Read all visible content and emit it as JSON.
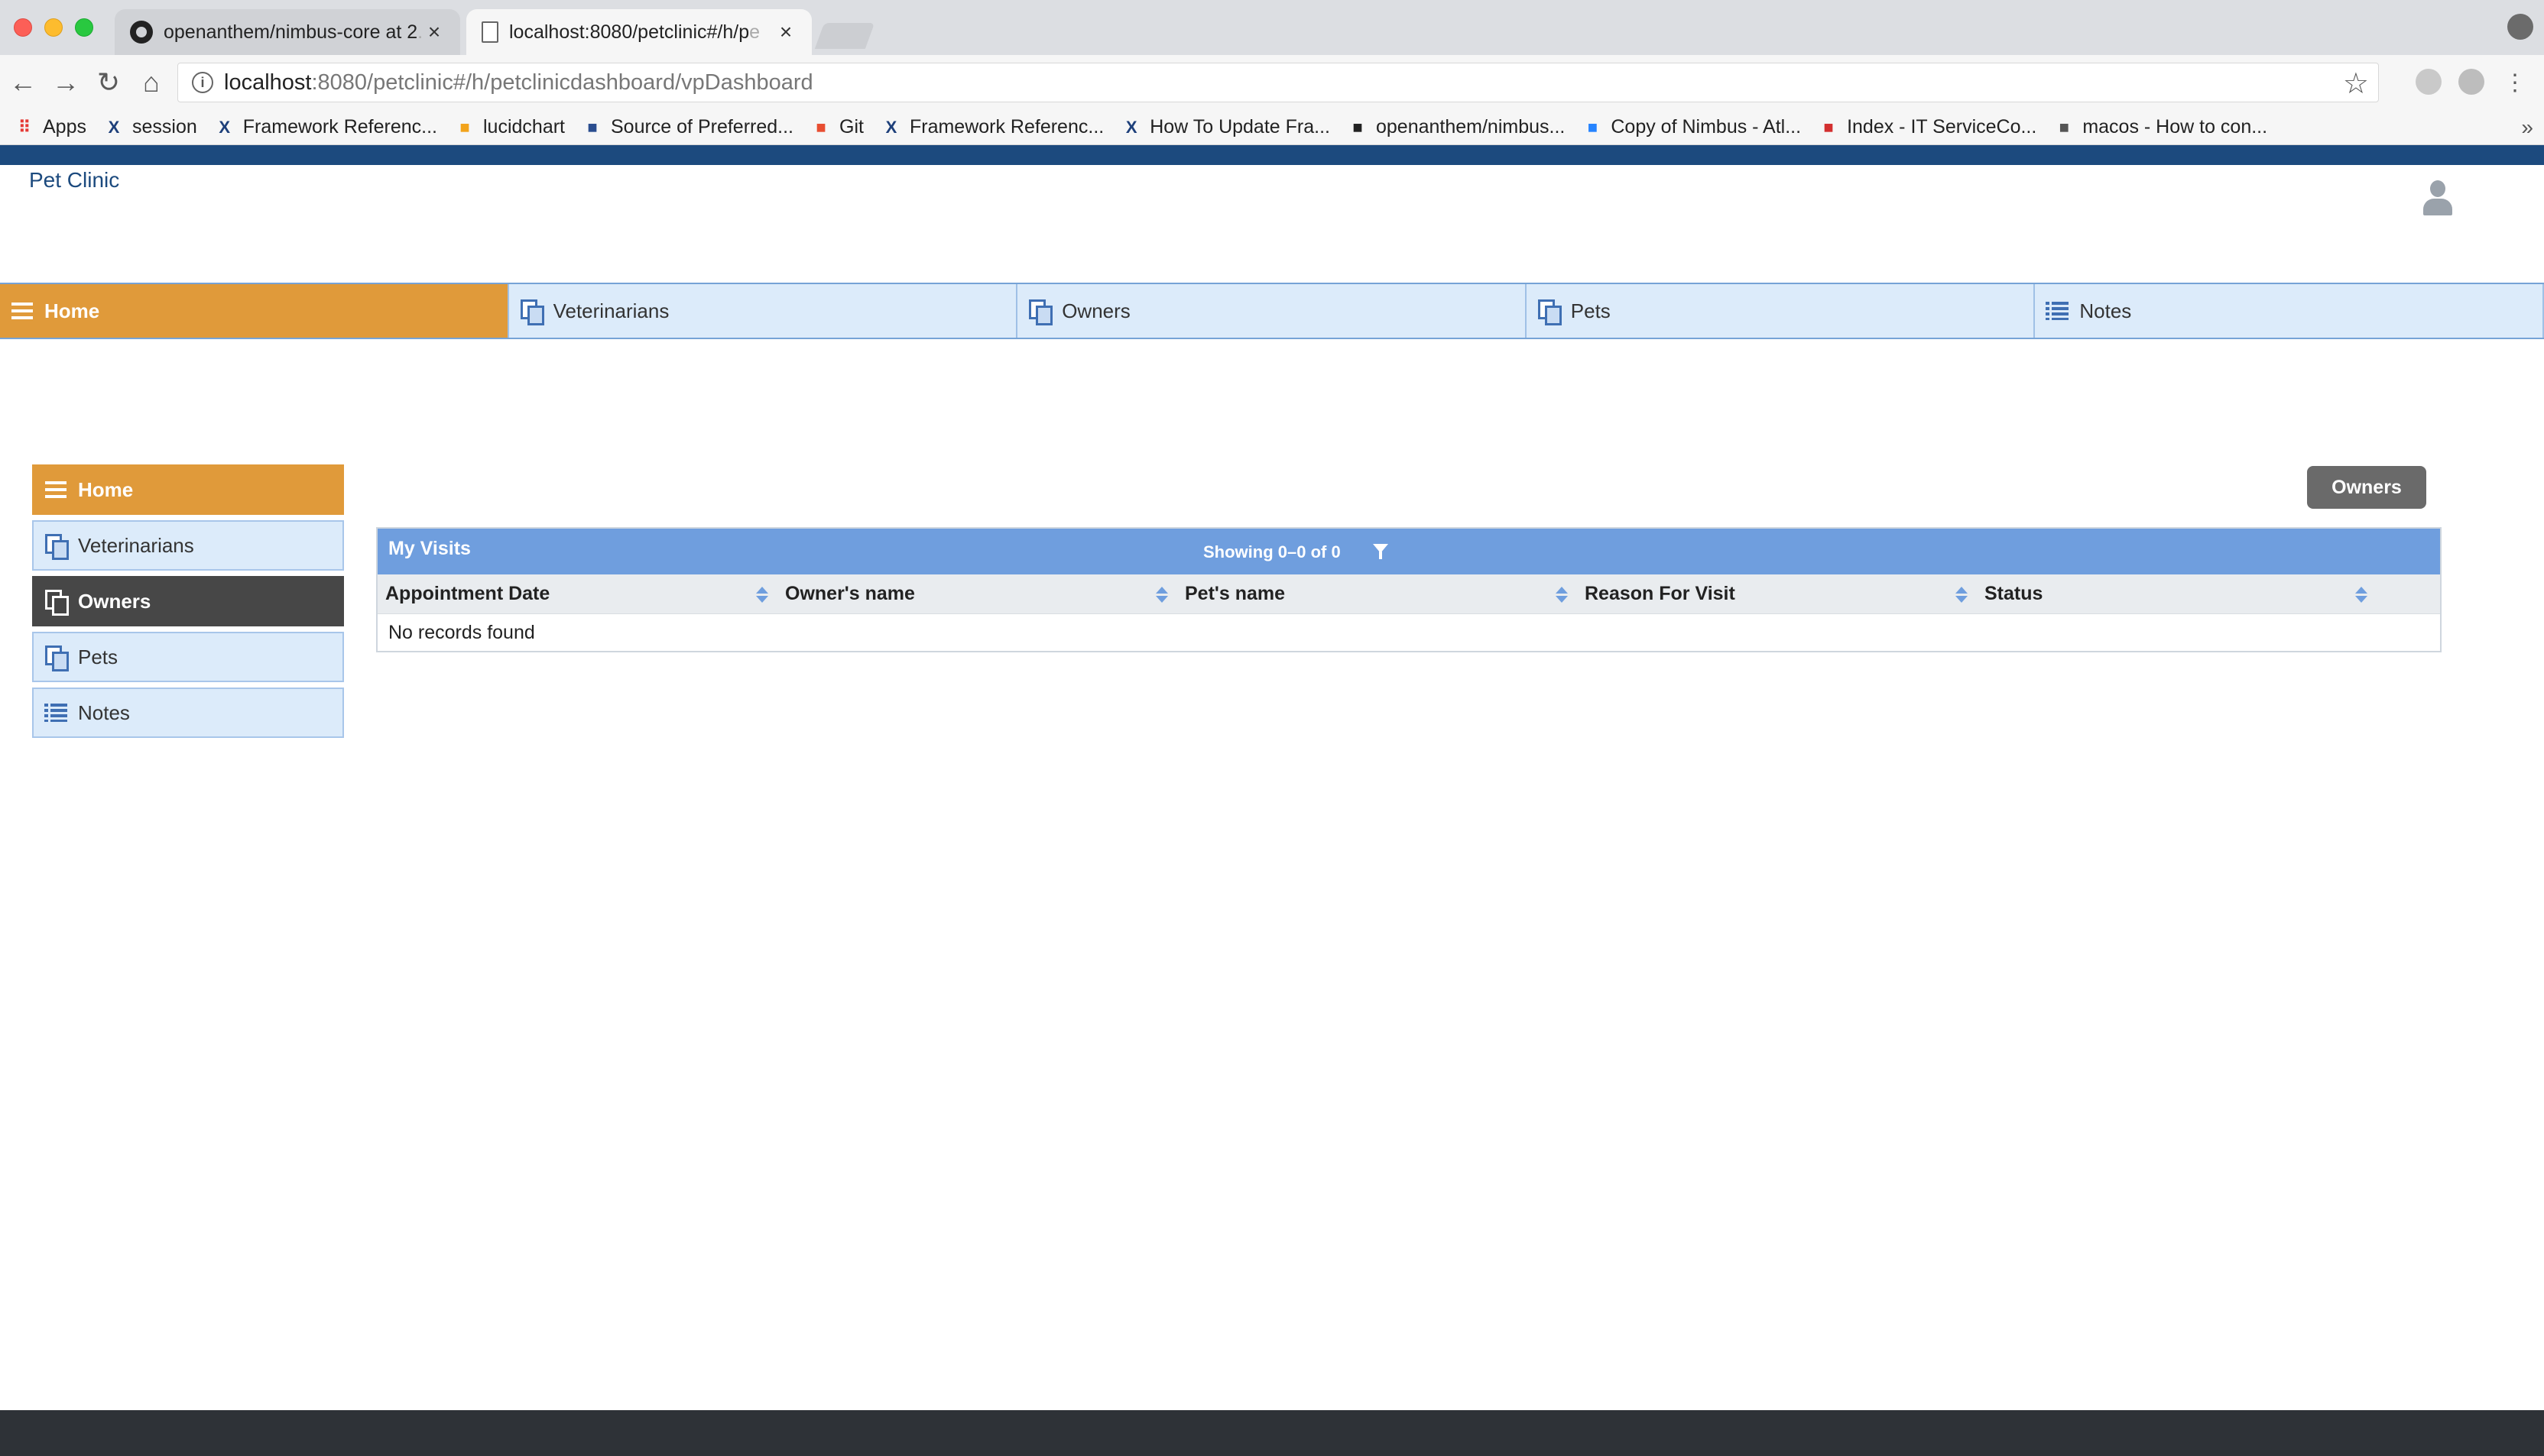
{
  "browser": {
    "tabs": [
      {
        "title": "openanthem/nimbus-core at 2",
        "title_faded": ".",
        "icon": "github-icon"
      },
      {
        "title": "localhost:8080/petclinic#/h/p",
        "title_faded": "e",
        "icon": "document-icon"
      }
    ],
    "url": {
      "host": "localhost",
      "rest": ":8080/petclinic#/h/petclinicdashboard/vpDashboard"
    },
    "bookmarks": [
      {
        "label": "Apps",
        "icon": "apps-grid-icon",
        "color": "#e53935"
      },
      {
        "label": "session",
        "icon": "x-icon",
        "color": "#1d3f7a"
      },
      {
        "label": "Framework Referenc...",
        "icon": "x-icon",
        "color": "#1d3f7a"
      },
      {
        "label": "lucidchart",
        "icon": "lucidchart-icon",
        "color": "#f2a31b"
      },
      {
        "label": "Source of Preferred...",
        "icon": "shield-icon",
        "color": "#2a4d8f"
      },
      {
        "label": "Git",
        "icon": "git-icon",
        "color": "#e84e31"
      },
      {
        "label": "Framework Referenc...",
        "icon": "x-icon",
        "color": "#1d3f7a"
      },
      {
        "label": "How To Update Fra...",
        "icon": "x-icon",
        "color": "#1d3f7a"
      },
      {
        "label": "openanthem/nimbus...",
        "icon": "github-icon",
        "color": "#222222"
      },
      {
        "label": "Copy of Nimbus - Atl...",
        "icon": "confluence-icon",
        "color": "#2684ff"
      },
      {
        "label": "Index - IT ServiceCo...",
        "icon": "servicenow-icon",
        "color": "#d32f2f"
      },
      {
        "label": "macos - How to con...",
        "icon": "stackoverflow-icon",
        "color": "#555555"
      }
    ],
    "bookmarks_more": "»"
  },
  "app": {
    "title": "Pet Clinic",
    "colors": {
      "brand": "#1c4a7e",
      "active": "#e09a3a",
      "nav_bg": "#dcebfa",
      "grid_header": "#6f9ede",
      "dark": "#474747"
    },
    "top_nav": [
      {
        "label": "Home",
        "icon": "menu-lines-icon",
        "active": true
      },
      {
        "label": "Veterinarians",
        "icon": "copy-icon",
        "active": false
      },
      {
        "label": "Owners",
        "icon": "copy-icon",
        "active": false
      },
      {
        "label": "Pets",
        "icon": "copy-icon",
        "active": false
      },
      {
        "label": "Notes",
        "icon": "list-icon",
        "active": false
      }
    ],
    "side_nav": [
      {
        "label": "Home",
        "icon": "menu-lines-icon",
        "state": "active"
      },
      {
        "label": "Veterinarians",
        "icon": "copy-icon",
        "state": "normal"
      },
      {
        "label": "Owners",
        "icon": "copy-icon",
        "state": "selected"
      },
      {
        "label": "Pets",
        "icon": "copy-icon",
        "state": "normal"
      },
      {
        "label": "Notes",
        "icon": "list-icon",
        "state": "normal"
      }
    ],
    "owners_button": "Owners",
    "grid": {
      "title": "My Visits",
      "count": "Showing 0–0 of 0",
      "columns": [
        "Appointment Date",
        "Owner's name",
        "Pet's name",
        "Reason For Visit",
        "Status"
      ],
      "empty_message": "No records found"
    }
  }
}
